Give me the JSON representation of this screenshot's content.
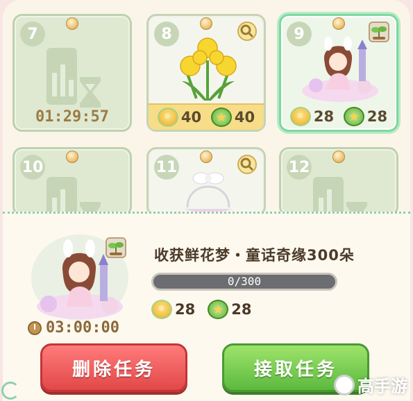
{
  "cards": [
    {
      "number": "7",
      "state": "waiting",
      "timer": "01:29:57"
    },
    {
      "number": "8",
      "state": "reward",
      "reward_a": "40",
      "reward_b": "40"
    },
    {
      "number": "9",
      "state": "selected",
      "reward_a": "28",
      "reward_b": "28"
    },
    {
      "number": "10",
      "state": "waiting"
    },
    {
      "number": "11",
      "state": "reward"
    },
    {
      "number": "12",
      "state": "waiting"
    }
  ],
  "task": {
    "title": "收获鲜花梦・童话奇缘300朵",
    "progress_text": "0/300",
    "progress_fraction": 0.0,
    "reward_a": "28",
    "reward_b": "28",
    "duration": "03:00:00"
  },
  "buttons": {
    "delete": "删除任务",
    "accept": "接取任务"
  },
  "watermark": "高手游",
  "icons": {
    "magnifier": "magnifier-icon",
    "sprout": "sprout-icon",
    "chick_coin": "chick-coin-icon",
    "star_coin": "star-coin-icon",
    "clock": "clock-icon"
  },
  "colors": {
    "card_bg": "#dfe9d2",
    "selected_border": "#7fd79f",
    "reward_bar": "#f7dd88",
    "delete_button": "#e24848",
    "accept_button": "#5cba3f"
  }
}
